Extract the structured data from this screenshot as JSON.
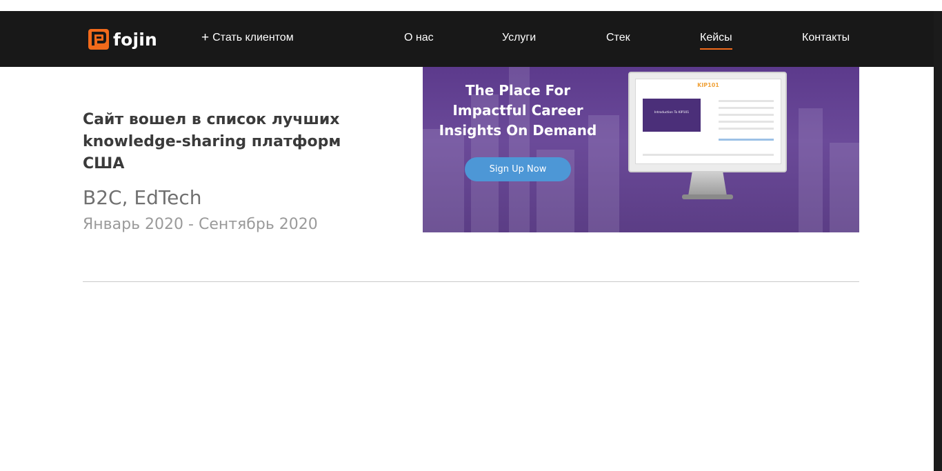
{
  "header": {
    "logo_text": "fojin",
    "become_client_label": "Стать клиентом",
    "nav": [
      {
        "label": "О нас",
        "active": false
      },
      {
        "label": "Услуги",
        "active": false
      },
      {
        "label": "Стек",
        "active": false
      },
      {
        "label": "Кейсы",
        "active": true
      },
      {
        "label": "Контакты",
        "active": false
      }
    ],
    "accent_color": "#f26a1b"
  },
  "case": {
    "title": "Сайт вошел в список лучших knowledge-sharing платформ США",
    "tags": "B2C, EdTech",
    "dates": "Январь 2020 - Сентябрь 2020",
    "image": {
      "headline": "The Place For Impactful Career Insights On Demand",
      "button_label": "Sign Up Now",
      "screen_logo": "KIP101",
      "video_caption": "Introduction To KIP101"
    }
  },
  "icons": [
    "fojin-logo-icon",
    "plus-icon"
  ]
}
